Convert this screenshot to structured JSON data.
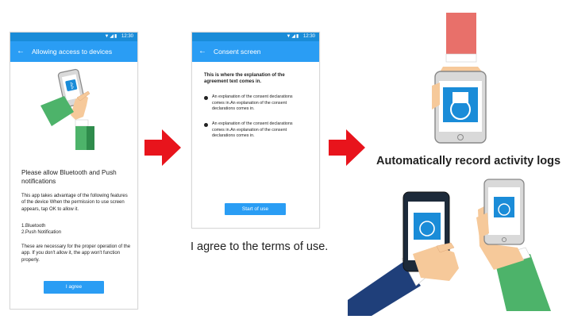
{
  "screen1": {
    "status_time": "12:30",
    "title": "Allowing access to devices",
    "heading": "Please allow Bluetooth and Push notifications",
    "intro": "This app takes advantage of the following features of the device When the permission to use screen appears, tap OK to allow it.",
    "item1": "1.Bluetooth",
    "item2": "2.Push Notification",
    "note": "These are necessary for the proper operation of the app. If you don't allow it, the app won't function properly.",
    "button_label": "I agree"
  },
  "screen2": {
    "status_time": "12:30",
    "title": "Consent screen",
    "intro": "This is where the explanation of the agreement text comes in.",
    "bullets": [
      "An explanation of the consent declarations comes in.An explanation of the consent declarations comes in.",
      "An explanation of the consent declarations comes in.An explanation of the consent declarations comes in."
    ],
    "button_label": "Start of use"
  },
  "captions": {
    "agree": "I agree to the terms of use.",
    "record": "Automatically record activity logs"
  },
  "icons": [
    "back-arrow-icon",
    "bluetooth-icon",
    "app-logo-icon",
    "wifi-icon",
    "signal-icon",
    "battery-icon",
    "right-arrow-icon"
  ],
  "colors": {
    "appbar": "#2a9df4",
    "statusbar": "#1a8cd8",
    "arrow": "#e8141c",
    "sleeve_red": "#e8706a",
    "sleeve_green": "#4db36a",
    "sleeve_navy": "#1f3f7a",
    "skin": "#f6c99a"
  }
}
